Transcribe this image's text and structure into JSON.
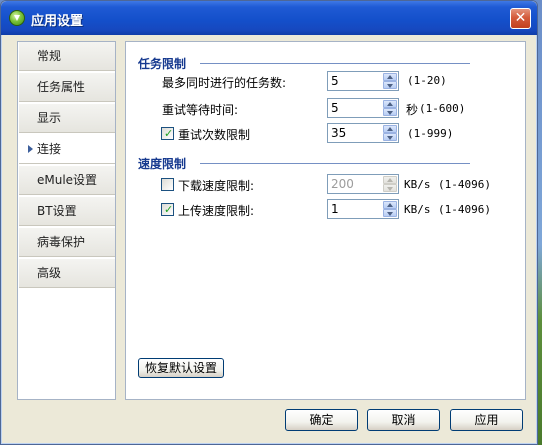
{
  "window": {
    "title": "应用设置",
    "close_label": "✕"
  },
  "nav": {
    "items": [
      {
        "label": "常规"
      },
      {
        "label": "任务属性"
      },
      {
        "label": "显示"
      },
      {
        "label": "连接",
        "active": true
      },
      {
        "label": "eMule设置"
      },
      {
        "label": "BT设置"
      },
      {
        "label": "病毒保护"
      },
      {
        "label": "高级"
      }
    ]
  },
  "task_limits": {
    "title": "任务限制",
    "max_tasks": {
      "label": "最多同时进行的任务数:",
      "value": "5",
      "range": "(1-20)"
    },
    "retry_wait": {
      "label": "重试等待时间:",
      "value": "5",
      "unit": "秒",
      "range": "(1-600)"
    },
    "retry_count": {
      "label": "重试次数限制",
      "checked": true,
      "value": "35",
      "range": "(1-999)"
    }
  },
  "speed_limits": {
    "title": "速度限制",
    "download": {
      "label": "下载速度限制:",
      "checked": false,
      "value": "200",
      "unit": "KB/s",
      "range": "(1-4096)"
    },
    "upload": {
      "label": "上传速度限制:",
      "checked": true,
      "value": "1",
      "unit": "KB/s",
      "range": "(1-4096)"
    }
  },
  "restore_defaults_label": "恢复默认设置",
  "footer": {
    "ok_label": "确定",
    "cancel_label": "取消",
    "apply_label": "应用"
  },
  "icons": {
    "app": "app-icon",
    "close": "close-icon",
    "check": "checkmark-icon"
  },
  "colors": {
    "title_bar": "#1450cb",
    "group_title": "#16398f",
    "dialog_bg": "#ece9d8"
  }
}
